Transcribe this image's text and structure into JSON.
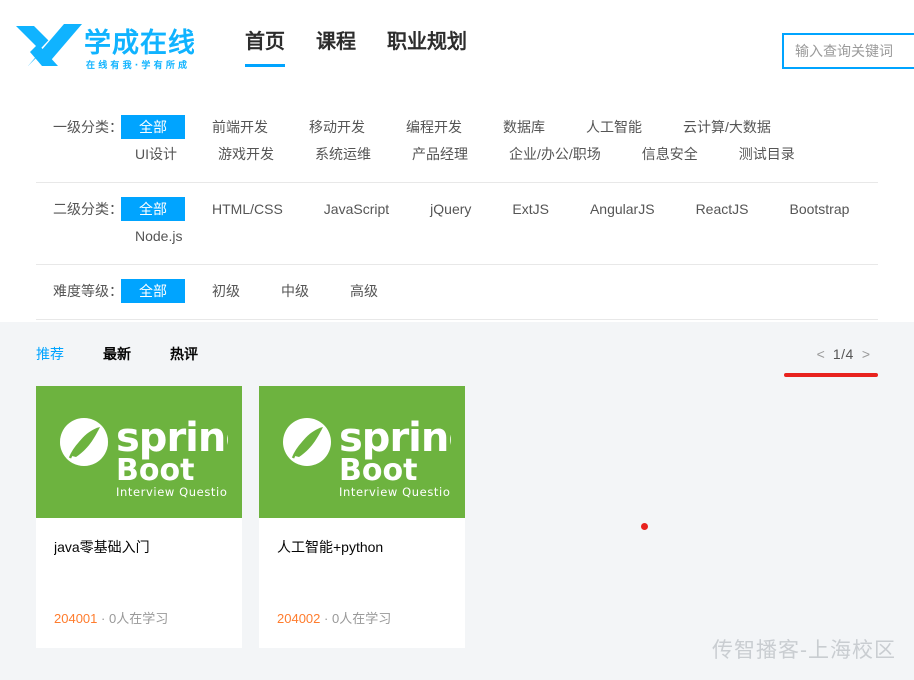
{
  "header": {
    "logo": {
      "mark": "x-logo-icon",
      "brand": "学成在线",
      "tagline": "在线有我·学有所成",
      "color": "#10b3ff"
    },
    "nav": [
      {
        "label": "首页",
        "active": true
      },
      {
        "label": "课程",
        "active": false
      },
      {
        "label": "职业规划",
        "active": false
      }
    ],
    "search": {
      "placeholder": "输入查询关键词",
      "value": "",
      "border_color": "#00a4ff"
    }
  },
  "filters": [
    {
      "label": "一级分类：",
      "options": [
        "全部",
        "前端开发",
        "移动开发",
        "编程开发",
        "数据库",
        "人工智能",
        "云计算/大数据",
        "UI设计",
        "游戏开发",
        "系统运维",
        "产品经理",
        "企业/办公/职场",
        "信息安全",
        "测试目录"
      ],
      "selected": "全部"
    },
    {
      "label": "二级分类：",
      "options": [
        "全部",
        "HTML/CSS",
        "JavaScript",
        "jQuery",
        "ExtJS",
        "AngularJS",
        "ReactJS",
        "Bootstrap",
        "Node.js"
      ],
      "selected": "全部"
    },
    {
      "label": "难度等级：",
      "options": [
        "全部",
        "初级",
        "中级",
        "高级"
      ],
      "selected": "全部"
    }
  ],
  "content": {
    "sort_tabs": [
      {
        "label": "推荐",
        "active": true
      },
      {
        "label": "最新",
        "active": false
      },
      {
        "label": "热评",
        "active": false
      }
    ],
    "pager": {
      "prev": "<",
      "next": ">",
      "count": "1/4",
      "underline_color": "#e8221e"
    },
    "cards": [
      {
        "image": {
          "brand_top": "spring",
          "brand_bottom": "Boot",
          "subtitle": "Interview Questions",
          "bg_color": "#6db33f"
        },
        "title": "java零基础入门",
        "code": "204001",
        "separator": "·",
        "learners": "0人在学习"
      },
      {
        "image": {
          "brand_top": "spring",
          "brand_bottom": "Boot",
          "subtitle": "Interview Questions",
          "bg_color": "#6db33f"
        },
        "title": "人工智能+python",
        "code": "204002",
        "separator": "·",
        "learners": "0人在学习"
      }
    ]
  },
  "watermark": "传智播客-上海校区"
}
